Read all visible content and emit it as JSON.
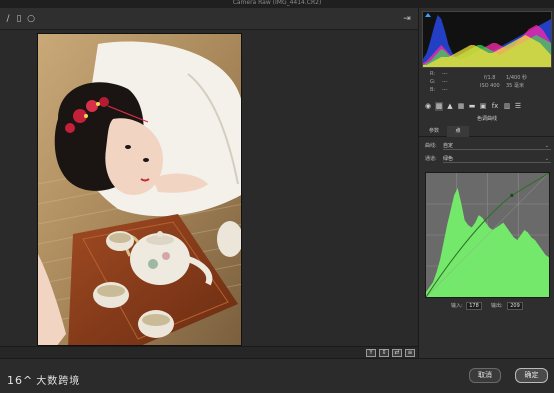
{
  "window": {
    "title": "Camera Raw (IMG_4414.CR2)"
  },
  "toolbar": {
    "tools": [
      {
        "name": "straighten-tool",
        "glyph": "∕"
      },
      {
        "name": "crop-tool",
        "glyph": "▯"
      },
      {
        "name": "radial-filter-tool",
        "glyph": "○"
      }
    ],
    "export_glyph": "⇥"
  },
  "histogram": {
    "clip_color": "#3aa0ff",
    "bars": [
      {
        "color": "#2a4fff",
        "h": [
          8,
          14,
          26,
          40,
          52,
          48,
          36,
          22,
          14,
          10,
          8,
          8,
          9,
          10,
          11,
          12,
          12,
          13,
          14,
          16,
          18,
          20,
          22,
          24,
          26,
          28,
          30,
          32,
          34,
          36,
          38,
          40,
          42,
          44,
          46,
          48
        ]
      },
      {
        "color": "#ff2aa8",
        "h": [
          4,
          6,
          10,
          14,
          18,
          22,
          18,
          14,
          10,
          8,
          8,
          9,
          10,
          12,
          14,
          16,
          18,
          20,
          22,
          24,
          24,
          22,
          20,
          18,
          20,
          22,
          26,
          30,
          34,
          38,
          40,
          42,
          40,
          36,
          30,
          24
        ]
      },
      {
        "color": "#31d35a",
        "h": [
          2,
          4,
          6,
          10,
          14,
          18,
          16,
          12,
          10,
          10,
          12,
          14,
          16,
          18,
          20,
          22,
          22,
          20,
          18,
          16,
          14,
          12,
          14,
          16,
          18,
          20,
          22,
          24,
          26,
          28,
          30,
          32,
          30,
          28,
          26,
          24
        ]
      },
      {
        "color": "#f2e33a",
        "h": [
          2,
          2,
          4,
          6,
          8,
          10,
          10,
          10,
          12,
          14,
          16,
          18,
          20,
          22,
          22,
          20,
          18,
          16,
          14,
          14,
          16,
          18,
          20,
          22,
          24,
          26,
          28,
          30,
          32,
          30,
          28,
          26,
          24,
          20,
          16,
          12
        ]
      }
    ]
  },
  "info": {
    "r_label": "R:",
    "g_label": "G:",
    "b_label": "B:",
    "r_value": "---",
    "g_value": "---",
    "b_value": "---",
    "aperture": "f/1.8",
    "shutter": "1/400 秒",
    "iso": "ISO 400",
    "focal": "35 毫米"
  },
  "panel_icons": [
    {
      "name": "basic-panel-icon",
      "glyph": "◉"
    },
    {
      "name": "tone-curve-panel-icon",
      "glyph": "▩"
    },
    {
      "name": "detail-panel-icon",
      "glyph": "▲"
    },
    {
      "name": "hsl-panel-icon",
      "glyph": "▦"
    },
    {
      "name": "split-toning-panel-icon",
      "glyph": "▬"
    },
    {
      "name": "lens-corrections-panel-icon",
      "glyph": "▣"
    },
    {
      "name": "effects-panel-icon",
      "glyph": "fx"
    },
    {
      "name": "camera-calibration-panel-icon",
      "glyph": "▥"
    },
    {
      "name": "presets-panel-icon",
      "glyph": "☰"
    }
  ],
  "section_title": "色调曲线",
  "tabs": [
    {
      "label": "参数"
    },
    {
      "label": "点"
    }
  ],
  "curve_row": {
    "label": "曲线:",
    "value": "自定"
  },
  "channel_row": {
    "label": "通道:",
    "value": "绿色"
  },
  "curve": {
    "area_color": "#74e86a",
    "line_color": "#2e6e2a",
    "grid_color": "#8a8a8a",
    "profile": [
      0.04,
      0.08,
      0.12,
      0.2,
      0.3,
      0.44,
      0.58,
      0.7,
      0.82,
      0.88,
      0.76,
      0.62,
      0.58,
      0.56,
      0.6,
      0.66,
      0.64,
      0.6,
      0.56,
      0.54,
      0.56,
      0.58,
      0.6,
      0.56,
      0.52,
      0.48,
      0.46,
      0.5,
      0.54,
      0.52,
      0.48,
      0.46,
      0.42,
      0.38,
      0.34,
      0.32
    ]
  },
  "io": {
    "input_label": "输入:",
    "input_value": "178",
    "output_label": "输出:",
    "output_value": "209"
  },
  "view_buttons": [
    {
      "name": "y-view-button",
      "glyph": "Y"
    },
    {
      "name": "compare-view-button",
      "glyph": "⇕"
    },
    {
      "name": "swap-view-button",
      "glyph": "⇄"
    },
    {
      "name": "settings-view-button",
      "glyph": "≡"
    }
  ],
  "logo": {
    "mark": "16^",
    "text": "大数跨境"
  },
  "buttons": {
    "cancel": "取消",
    "ok": "确定"
  }
}
